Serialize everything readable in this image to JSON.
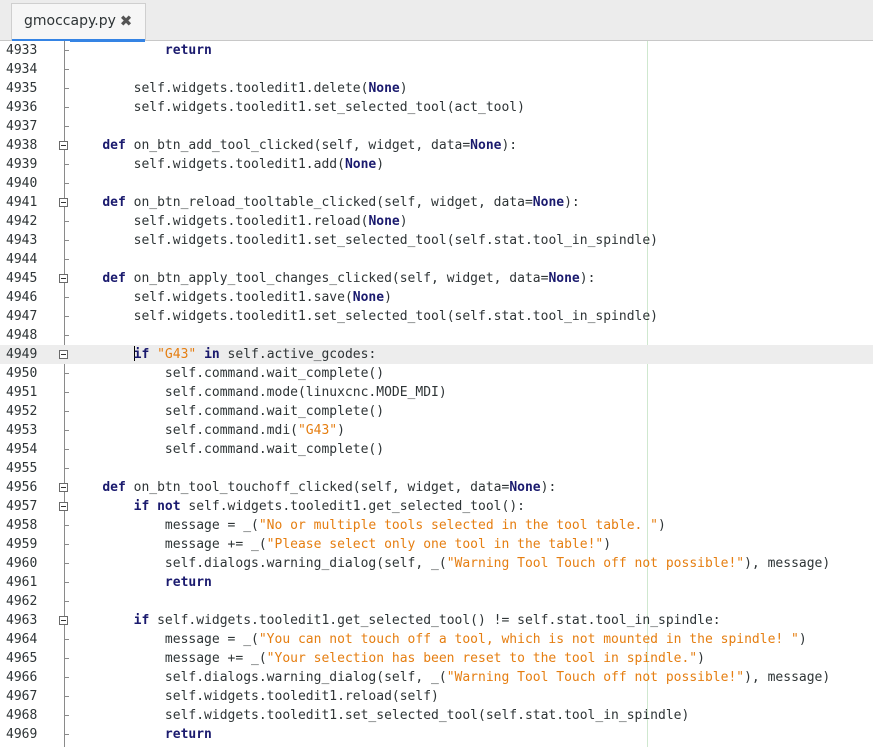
{
  "tab": {
    "title": "gmoccapy.py",
    "close_glyph": "✖"
  },
  "lines": [
    {
      "n": "4933",
      "marker": "tick",
      "indent": 12,
      "tokens": [
        [
          "kw",
          "return"
        ]
      ]
    },
    {
      "n": "4934",
      "marker": "tick",
      "indent": 0,
      "tokens": []
    },
    {
      "n": "4935",
      "marker": "tick",
      "indent": 8,
      "tokens": [
        [
          "t",
          "self.widgets.tooledit1.delete("
        ],
        [
          "kw",
          "None"
        ],
        [
          "t",
          ")"
        ]
      ]
    },
    {
      "n": "4936",
      "marker": "tick",
      "indent": 8,
      "tokens": [
        [
          "t",
          "self.widgets.tooledit1.set_selected_tool(act_tool)"
        ]
      ]
    },
    {
      "n": "4937",
      "marker": "tick",
      "indent": 0,
      "tokens": []
    },
    {
      "n": "4938",
      "marker": "fold",
      "indent": 4,
      "tokens": [
        [
          "kw",
          "def"
        ],
        [
          "t",
          " on_btn_add_tool_clicked(self, widget, data="
        ],
        [
          "kw",
          "None"
        ],
        [
          "t",
          "):"
        ]
      ]
    },
    {
      "n": "4939",
      "marker": "tick",
      "indent": 8,
      "tokens": [
        [
          "t",
          "self.widgets.tooledit1.add("
        ],
        [
          "kw",
          "None"
        ],
        [
          "t",
          ")"
        ]
      ]
    },
    {
      "n": "4940",
      "marker": "tick",
      "indent": 0,
      "tokens": []
    },
    {
      "n": "4941",
      "marker": "fold",
      "indent": 4,
      "tokens": [
        [
          "kw",
          "def"
        ],
        [
          "t",
          " on_btn_reload_tooltable_clicked(self, widget, data="
        ],
        [
          "kw",
          "None"
        ],
        [
          "t",
          "):"
        ]
      ]
    },
    {
      "n": "4942",
      "marker": "tick",
      "indent": 8,
      "tokens": [
        [
          "t",
          "self.widgets.tooledit1.reload("
        ],
        [
          "kw",
          "None"
        ],
        [
          "t",
          ")"
        ]
      ]
    },
    {
      "n": "4943",
      "marker": "tick",
      "indent": 8,
      "tokens": [
        [
          "t",
          "self.widgets.tooledit1.set_selected_tool(self.stat.tool_in_spindle)"
        ]
      ]
    },
    {
      "n": "4944",
      "marker": "tick",
      "indent": 0,
      "tokens": []
    },
    {
      "n": "4945",
      "marker": "fold",
      "indent": 4,
      "tokens": [
        [
          "kw",
          "def"
        ],
        [
          "t",
          " on_btn_apply_tool_changes_clicked(self, widget, data="
        ],
        [
          "kw",
          "None"
        ],
        [
          "t",
          "):"
        ]
      ]
    },
    {
      "n": "4946",
      "marker": "tick",
      "indent": 8,
      "tokens": [
        [
          "t",
          "self.widgets.tooledit1.save("
        ],
        [
          "kw",
          "None"
        ],
        [
          "t",
          ")"
        ]
      ]
    },
    {
      "n": "4947",
      "marker": "tick",
      "indent": 8,
      "tokens": [
        [
          "t",
          "self.widgets.tooledit1.set_selected_tool(self.stat.tool_in_spindle)"
        ]
      ]
    },
    {
      "n": "4948",
      "marker": "tick",
      "indent": 0,
      "tokens": []
    },
    {
      "n": "4949",
      "marker": "fold",
      "indent": 8,
      "current": true,
      "tokens": [
        [
          "caret",
          ""
        ],
        [
          "kw",
          "if"
        ],
        [
          "t",
          " "
        ],
        [
          "str",
          "\"G43\""
        ],
        [
          "t",
          " "
        ],
        [
          "kw",
          "in"
        ],
        [
          "t",
          " self.active_gcodes:"
        ]
      ]
    },
    {
      "n": "4950",
      "marker": "tick",
      "indent": 12,
      "tokens": [
        [
          "t",
          "self.command.wait_complete()"
        ]
      ]
    },
    {
      "n": "4951",
      "marker": "tick",
      "indent": 12,
      "tokens": [
        [
          "t",
          "self.command.mode(linuxcnc.MODE_MDI)"
        ]
      ]
    },
    {
      "n": "4952",
      "marker": "tick",
      "indent": 12,
      "tokens": [
        [
          "t",
          "self.command.wait_complete()"
        ]
      ]
    },
    {
      "n": "4953",
      "marker": "tick",
      "indent": 12,
      "tokens": [
        [
          "t",
          "self.command.mdi("
        ],
        [
          "str",
          "\"G43\""
        ],
        [
          "t",
          ")"
        ]
      ]
    },
    {
      "n": "4954",
      "marker": "tick",
      "indent": 12,
      "tokens": [
        [
          "t",
          "self.command.wait_complete()"
        ]
      ]
    },
    {
      "n": "4955",
      "marker": "tick",
      "indent": 0,
      "tokens": []
    },
    {
      "n": "4956",
      "marker": "fold",
      "indent": 4,
      "tokens": [
        [
          "kw",
          "def"
        ],
        [
          "t",
          " on_btn_tool_touchoff_clicked(self, widget, data="
        ],
        [
          "kw",
          "None"
        ],
        [
          "t",
          "):"
        ]
      ]
    },
    {
      "n": "4957",
      "marker": "fold",
      "indent": 8,
      "tokens": [
        [
          "kw",
          "if"
        ],
        [
          "t",
          " "
        ],
        [
          "kw",
          "not"
        ],
        [
          "t",
          " self.widgets.tooledit1.get_selected_tool():"
        ]
      ]
    },
    {
      "n": "4958",
      "marker": "tick",
      "indent": 12,
      "tokens": [
        [
          "t",
          "message = _("
        ],
        [
          "str",
          "\"No or multiple tools selected in the tool table. \""
        ],
        [
          "t",
          ")"
        ]
      ]
    },
    {
      "n": "4959",
      "marker": "tick",
      "indent": 12,
      "tokens": [
        [
          "t",
          "message += _("
        ],
        [
          "str",
          "\"Please select only one tool in the table!\""
        ],
        [
          "t",
          ")"
        ]
      ]
    },
    {
      "n": "4960",
      "marker": "tick",
      "indent": 12,
      "tokens": [
        [
          "t",
          "self.dialogs.warning_dialog(self, _("
        ],
        [
          "str",
          "\"Warning Tool Touch off not possible!\""
        ],
        [
          "t",
          "), message)"
        ]
      ]
    },
    {
      "n": "4961",
      "marker": "tick",
      "indent": 12,
      "tokens": [
        [
          "kw",
          "return"
        ]
      ]
    },
    {
      "n": "4962",
      "marker": "tick",
      "indent": 0,
      "tokens": []
    },
    {
      "n": "4963",
      "marker": "fold",
      "indent": 8,
      "tokens": [
        [
          "kw",
          "if"
        ],
        [
          "t",
          " self.widgets.tooledit1.get_selected_tool() != self.stat.tool_in_spindle:"
        ]
      ]
    },
    {
      "n": "4964",
      "marker": "tick",
      "indent": 12,
      "tokens": [
        [
          "t",
          "message = _("
        ],
        [
          "str",
          "\"You can not touch off a tool, which is not mounted in the spindle! \""
        ],
        [
          "t",
          ")"
        ]
      ]
    },
    {
      "n": "4965",
      "marker": "tick",
      "indent": 12,
      "tokens": [
        [
          "t",
          "message += _("
        ],
        [
          "str",
          "\"Your selection has been reset to the tool in spindle.\""
        ],
        [
          "t",
          ")"
        ]
      ]
    },
    {
      "n": "4966",
      "marker": "tick",
      "indent": 12,
      "tokens": [
        [
          "t",
          "self.dialogs.warning_dialog(self, _("
        ],
        [
          "str",
          "\"Warning Tool Touch off not possible!\""
        ],
        [
          "t",
          "), message)"
        ]
      ]
    },
    {
      "n": "4967",
      "marker": "tick",
      "indent": 12,
      "tokens": [
        [
          "t",
          "self.widgets.tooledit1.reload(self)"
        ]
      ]
    },
    {
      "n": "4968",
      "marker": "tick",
      "indent": 12,
      "tokens": [
        [
          "t",
          "self.widgets.tooledit1.set_selected_tool(self.stat.tool_in_spindle)"
        ]
      ]
    },
    {
      "n": "4969",
      "marker": "tick",
      "indent": 12,
      "tokens": [
        [
          "kw",
          "return"
        ]
      ]
    }
  ]
}
